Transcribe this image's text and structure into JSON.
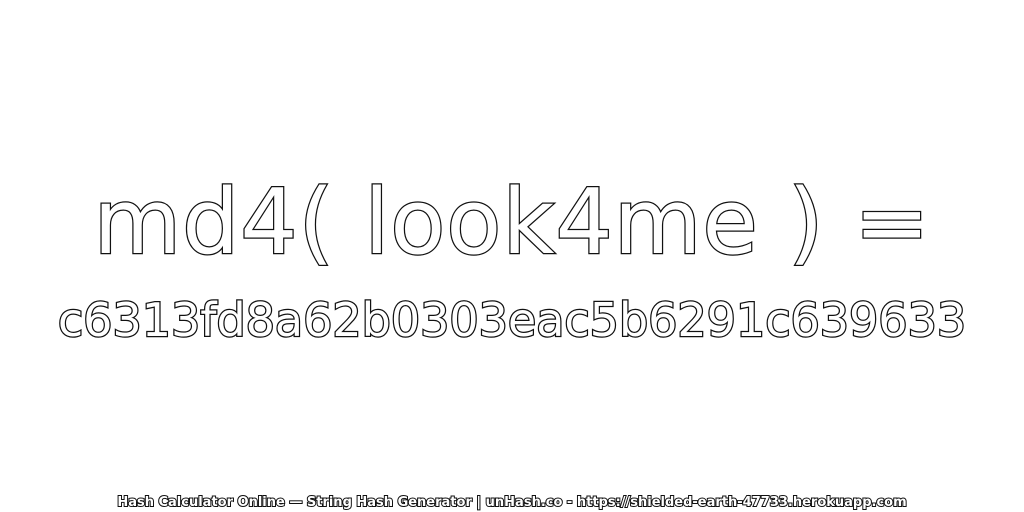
{
  "expression": "md4( look4me ) =",
  "hash": "c6313fd8a62b0303eac5b6291c639633",
  "footer": "Hash Calculator Online — String Hash Generator | unHash.co - https://shielded-earth-47733.herokuapp.com",
  "colors": {
    "background": "#ffffff",
    "text_fill": "#ffffff",
    "text_outline": "#111111"
  }
}
